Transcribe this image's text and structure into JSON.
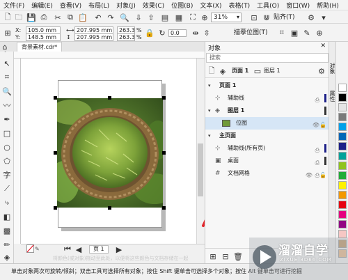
{
  "menu": [
    {
      "label": "文件(F)"
    },
    {
      "label": "编辑(E)"
    },
    {
      "label": "查看(V)"
    },
    {
      "label": "布局(L)"
    },
    {
      "label": "对象(J)"
    },
    {
      "label": "效果(C)"
    },
    {
      "label": "位图(B)"
    },
    {
      "label": "文本(X)"
    },
    {
      "label": "表格(T)"
    },
    {
      "label": "工具(O)"
    },
    {
      "label": "窗口(W)"
    },
    {
      "label": "帮助(H)"
    }
  ],
  "toolbar": {
    "zoom": "31%",
    "snap": "贴齐(T)"
  },
  "props": {
    "x": "105.0 mm",
    "y": "148.5 mm",
    "w": "207.995 mm",
    "h": "207.995 mm",
    "scale_w": "263.3",
    "scale_h": "263.3",
    "pct": "%",
    "angle": "0.0",
    "trace": "描摹位图(T)"
  },
  "document": {
    "tab": "背景素材.cdr*",
    "page_tab": "页 1",
    "hint": "将颜色(或对象)拖动至此处，以便将这些颜色与文档存储在一起"
  },
  "objects_panel": {
    "title": "对象",
    "search_placeholder": "搜索",
    "page_label": "页面 1",
    "layer_label": "图层 1",
    "tree": [
      {
        "label": "页面 1",
        "type": "header",
        "level": 0
      },
      {
        "label": "辅助线",
        "type": "item",
        "level": 1
      },
      {
        "label": "图层 1",
        "type": "header",
        "level": 1
      },
      {
        "label": "位图",
        "type": "selected",
        "level": 2
      },
      {
        "label": "主页面",
        "type": "header",
        "level": 0
      },
      {
        "label": "辅助线(所有页)",
        "type": "item",
        "level": 1
      },
      {
        "label": "桌面",
        "type": "item",
        "level": 1
      },
      {
        "label": "文档网格",
        "type": "item",
        "level": 1
      }
    ]
  },
  "side_tabs": [
    {
      "label": "对象"
    },
    {
      "label": "属性"
    }
  ],
  "palette": [
    "#ffffff",
    "#000000",
    "#e5e5e5",
    "#7a7a7a",
    "#00a0e9",
    "#0068b7",
    "#1d2088",
    "#00a29a",
    "#8fc31f",
    "#22ac38",
    "#fff100",
    "#f39800",
    "#e60012",
    "#e4007f",
    "#920783",
    "#f6c7c4",
    "#c7a47a",
    "#ebc29a"
  ],
  "status": {
    "text": "单击对象两次可旋转/倾斜；双击工具可选择所有对象；按住 Shift 键单击可选择多个对象；按住 Alt 键单击可进行挖掘"
  },
  "watermark": {
    "title": "溜溜自学",
    "subtitle": "ZIXUE.3D66.COM"
  }
}
